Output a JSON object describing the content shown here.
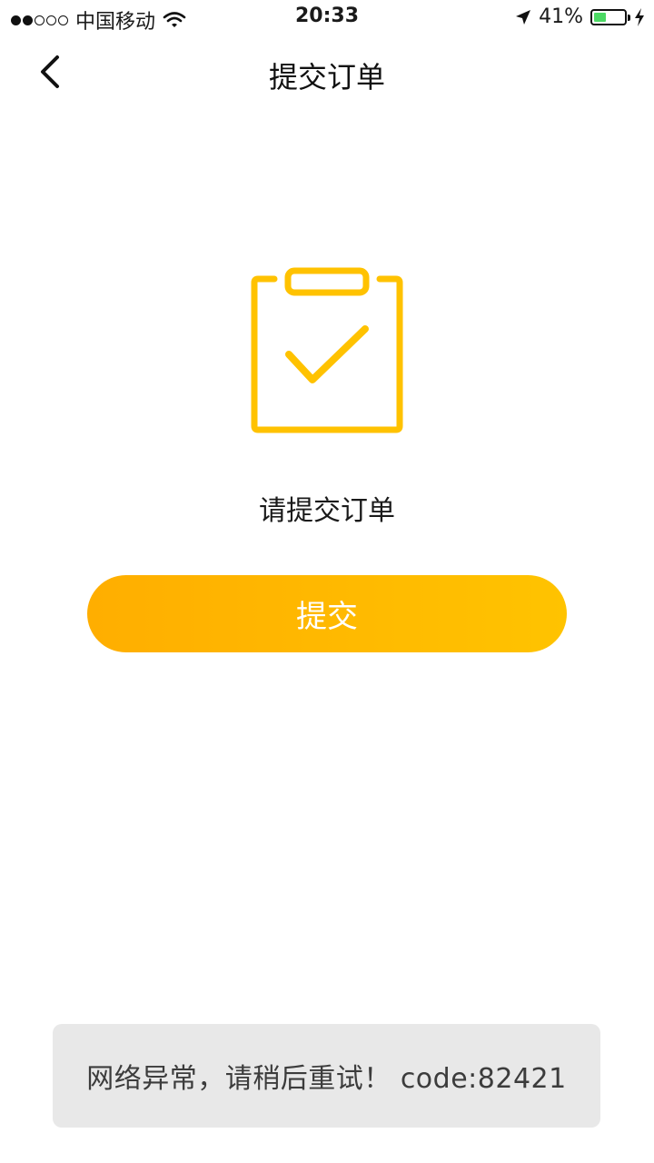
{
  "status_bar": {
    "carrier": "中国移动",
    "time": "20:33",
    "battery_percent": "41%",
    "battery_level": 0.41,
    "battery_color": "#4cd964",
    "signal_strength": 2,
    "signal_max": 5,
    "icons": [
      "wifi-icon",
      "location-arrow-icon",
      "battery-icon",
      "charging-bolt-icon"
    ]
  },
  "nav": {
    "title": "提交订单",
    "back_icon": "chevron-left-icon"
  },
  "main": {
    "illustration_icon": "clipboard-check-icon",
    "prompt": "请提交订单",
    "submit_label": "提交",
    "accent_color": "#ffb800"
  },
  "toast": {
    "message": "网络异常，请稍后重试！ code:82421"
  }
}
